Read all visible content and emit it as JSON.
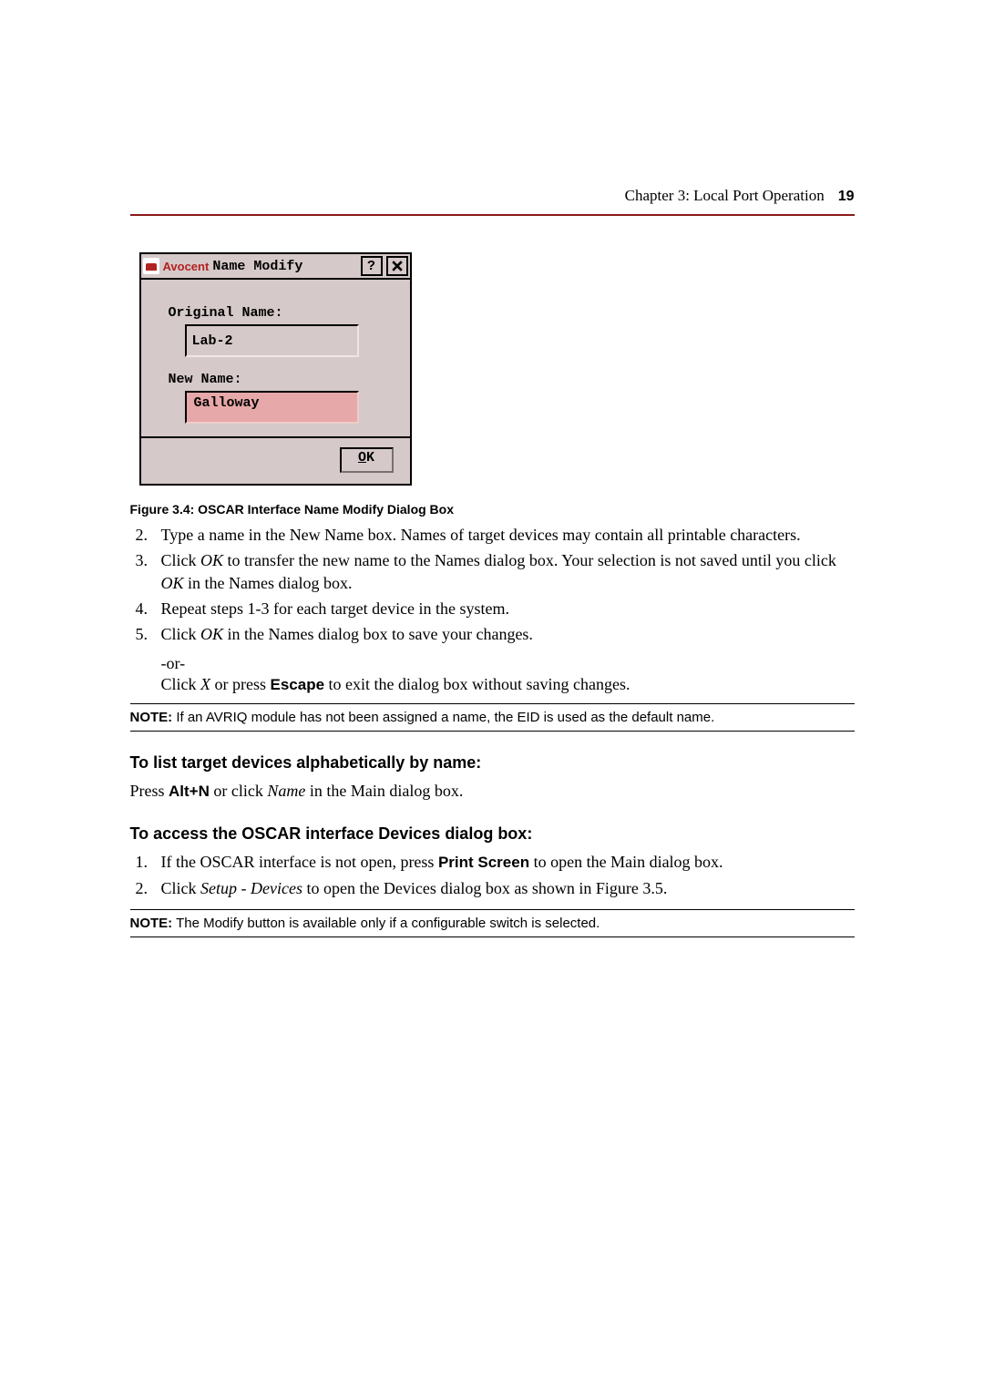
{
  "header": {
    "chapter": "Chapter 3: Local Port Operation",
    "page": "19"
  },
  "dialog": {
    "brand": "Avocent",
    "title": "Name Modify",
    "help": "?",
    "labels": {
      "original": "Original Name:",
      "newname": "New Name:"
    },
    "original_value": "Lab-2",
    "new_value": "Galloway",
    "ok_prefix": "O",
    "ok_rest": "K"
  },
  "caption": "Figure 3.4: OSCAR Interface Name Modify Dialog Box",
  "list1": {
    "start": 2,
    "item2": "Type a name in the New Name box. Names of target devices may contain all printable characters.",
    "item3a": "Click ",
    "item3_ok": "OK",
    "item3b": " to transfer the new name to the Names dialog box. Your selection is not saved until you click ",
    "item3_ok2": "OK",
    "item3c": " in the Names dialog box.",
    "item4": "Repeat steps 1-3 for each target device in the system.",
    "item5a": "Click ",
    "item5_ok": "OK",
    "item5b": " in the Names dialog box to save your changes."
  },
  "or": "-or-",
  "sub_a": "Click ",
  "sub_x": "X",
  "sub_b": " or press ",
  "sub_esc": "Escape",
  "sub_c": " to exit the dialog box without saving changes.",
  "note1_label": "NOTE:",
  "note1": " If an AVRIQ module has not been assigned a name, the EID is used as the default name.",
  "sect1": "To list target devices alphabetically by name:",
  "p1a": "Press ",
  "p1_key": "Alt+N",
  "p1b": " or click ",
  "p1_name": "Name",
  "p1c": " in the Main dialog box.",
  "sect2": "To access the OSCAR interface Devices dialog box:",
  "list2": {
    "item1a": "If the OSCAR interface is not open, press ",
    "item1_ps": "Print Screen",
    "item1b": " to open the Main dialog box.",
    "item2a": "Click ",
    "item2_sd": "Setup - Devices",
    "item2b": " to open the Devices dialog box as shown in Figure 3.5."
  },
  "note2_label": "NOTE:",
  "note2": " The Modify button is available only if a configurable switch is selected."
}
